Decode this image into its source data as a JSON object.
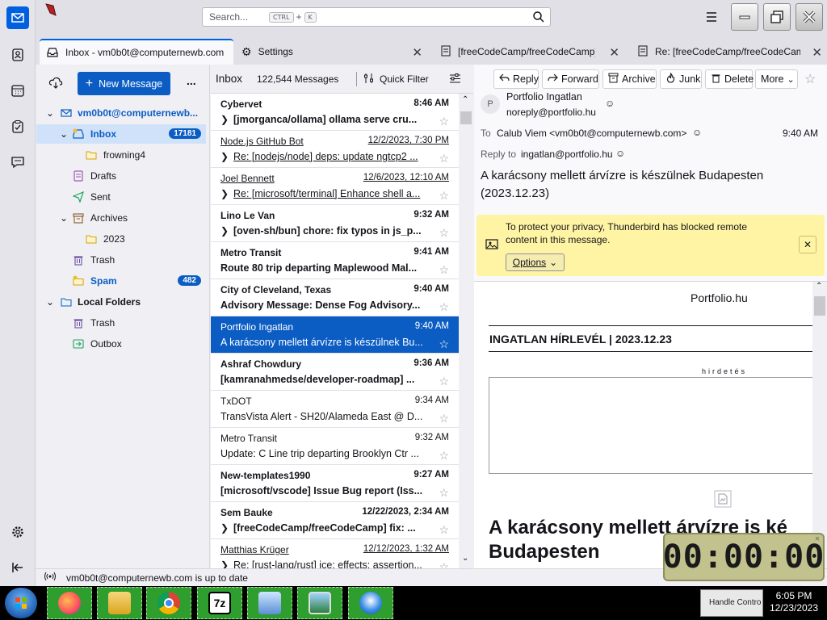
{
  "search": {
    "placeholder": "Search...",
    "key1": "CTRL",
    "plus": "+",
    "key2": "K"
  },
  "tabs": [
    {
      "label": "Inbox - vm0b0t@computernewb.com"
    },
    {
      "label": "Settings"
    },
    {
      "label": "[freeCodeCamp/freeCodeCamp] f"
    },
    {
      "label": "Re: [freeCodeCamp/freeCodeCam"
    }
  ],
  "folderpane": {
    "new_message": "New Message",
    "more": "...",
    "account": "vm0b0t@computernewb...",
    "folders": [
      {
        "label": "Inbox",
        "badge": "17181"
      },
      {
        "label": "frowning4"
      },
      {
        "label": "Drafts"
      },
      {
        "label": "Sent"
      },
      {
        "label": "Archives"
      },
      {
        "label": "2023"
      },
      {
        "label": "Trash"
      },
      {
        "label": "Spam",
        "badge": "482"
      },
      {
        "label": "Local Folders"
      },
      {
        "label": "Trash"
      },
      {
        "label": "Outbox"
      }
    ]
  },
  "list": {
    "folder": "Inbox",
    "count": "122,544 Messages",
    "quick_filter": "Quick Filter",
    "messages": [
      {
        "from": "Cybervet",
        "date": "8:46 AM",
        "subject": "[jmorganca/ollama] ollama serve cru...",
        "bold": true,
        "thread": true,
        "underline": false
      },
      {
        "from": "Node.js GitHub Bot",
        "date": "12/2/2023, 7:30 PM",
        "subject": "Re: [nodejs/node] deps: update ngtcp2 ...",
        "bold": false,
        "thread": true,
        "underline": true
      },
      {
        "from": "Joel Bennett",
        "date": "12/6/2023, 12:10 AM",
        "subject": "Re: [microsoft/terminal] Enhance shell a...",
        "bold": false,
        "thread": true,
        "underline": true
      },
      {
        "from": "Lino Le Van",
        "date": "9:32 AM",
        "subject": "[oven-sh/bun] chore: fix typos in js_p...",
        "bold": true,
        "thread": true,
        "underline": false
      },
      {
        "from": "Metro Transit",
        "date": "9:41 AM",
        "subject": "Route 80 trip departing Maplewood Mal...",
        "bold": true,
        "thread": false,
        "underline": false
      },
      {
        "from": "City of Cleveland, Texas",
        "date": "9:40 AM",
        "subject": "Advisory Message: Dense Fog Advisory...",
        "bold": true,
        "thread": false,
        "underline": false
      },
      {
        "from": "Portfolio Ingatlan",
        "date": "9:40 AM",
        "subject": "A karácsony mellett árvízre is készülnek Bu...",
        "bold": false,
        "thread": false,
        "underline": false,
        "selected": true
      },
      {
        "from": "Ashraf Chowdury",
        "date": "9:36 AM",
        "subject": "[kamranahmedse/developer-roadmap] ...",
        "bold": true,
        "thread": false,
        "underline": false
      },
      {
        "from": "TxDOT",
        "date": "9:34 AM",
        "subject": "TransVista Alert - SH20/Alameda East @ D...",
        "bold": false,
        "thread": false,
        "underline": false
      },
      {
        "from": "Metro Transit",
        "date": "9:32 AM",
        "subject": "Update: C Line trip departing Brooklyn Ctr ...",
        "bold": false,
        "thread": false,
        "underline": false
      },
      {
        "from": "New-templates1990",
        "date": "9:27 AM",
        "subject": "[microsoft/vscode] Issue Bug report (Iss...",
        "bold": true,
        "thread": false,
        "underline": false
      },
      {
        "from": "Sem Bauke",
        "date": "12/22/2023, 2:34 AM",
        "subject": "[freeCodeCamp/freeCodeCamp] fix: ...",
        "bold": true,
        "thread": true,
        "underline": false
      },
      {
        "from": "Matthias Krüger",
        "date": "12/12/2023, 1:32 AM",
        "subject": "Re: [rust-lang/rust] ice: effects: assertion...",
        "bold": false,
        "thread": true,
        "underline": true
      }
    ]
  },
  "reader": {
    "buttons": {
      "reply": "Reply",
      "forward": "Forward",
      "archive": "Archive",
      "junk": "Junk",
      "delete": "Delete",
      "more": "More"
    },
    "avatar_letter": "P",
    "from_name": "Portfolio Ingatlan",
    "from_email": "noreply@portfolio.hu",
    "to_label": "To",
    "to": "Calub Viem <vm0b0t@computernewb.com>",
    "time": "9:40 AM",
    "replyto_label": "Reply to",
    "replyto": "ingatlan@portfolio.hu",
    "subject": "A karácsony mellett árvízre is készülnek Budapesten (2023.12.23)",
    "privacy_text": "To protect your privacy, Thunderbird has blocked remote content in this message.",
    "options": "Options",
    "body": {
      "brand": "Portfolio.hu",
      "newsletter": "INGATLAN HÍRLEVÉL | 2023.12.23",
      "ad": "hirdetés",
      "headline": "A karácsony mellett árvízre is ké Budapesten"
    }
  },
  "status": {
    "text": "vm0b0t@computernewb.com is up to date"
  },
  "taskbar": {
    "time": "6:05 PM",
    "date": "12/23/2023",
    "tray": "Handle Contro"
  },
  "overlay_clock": "00:00:00"
}
